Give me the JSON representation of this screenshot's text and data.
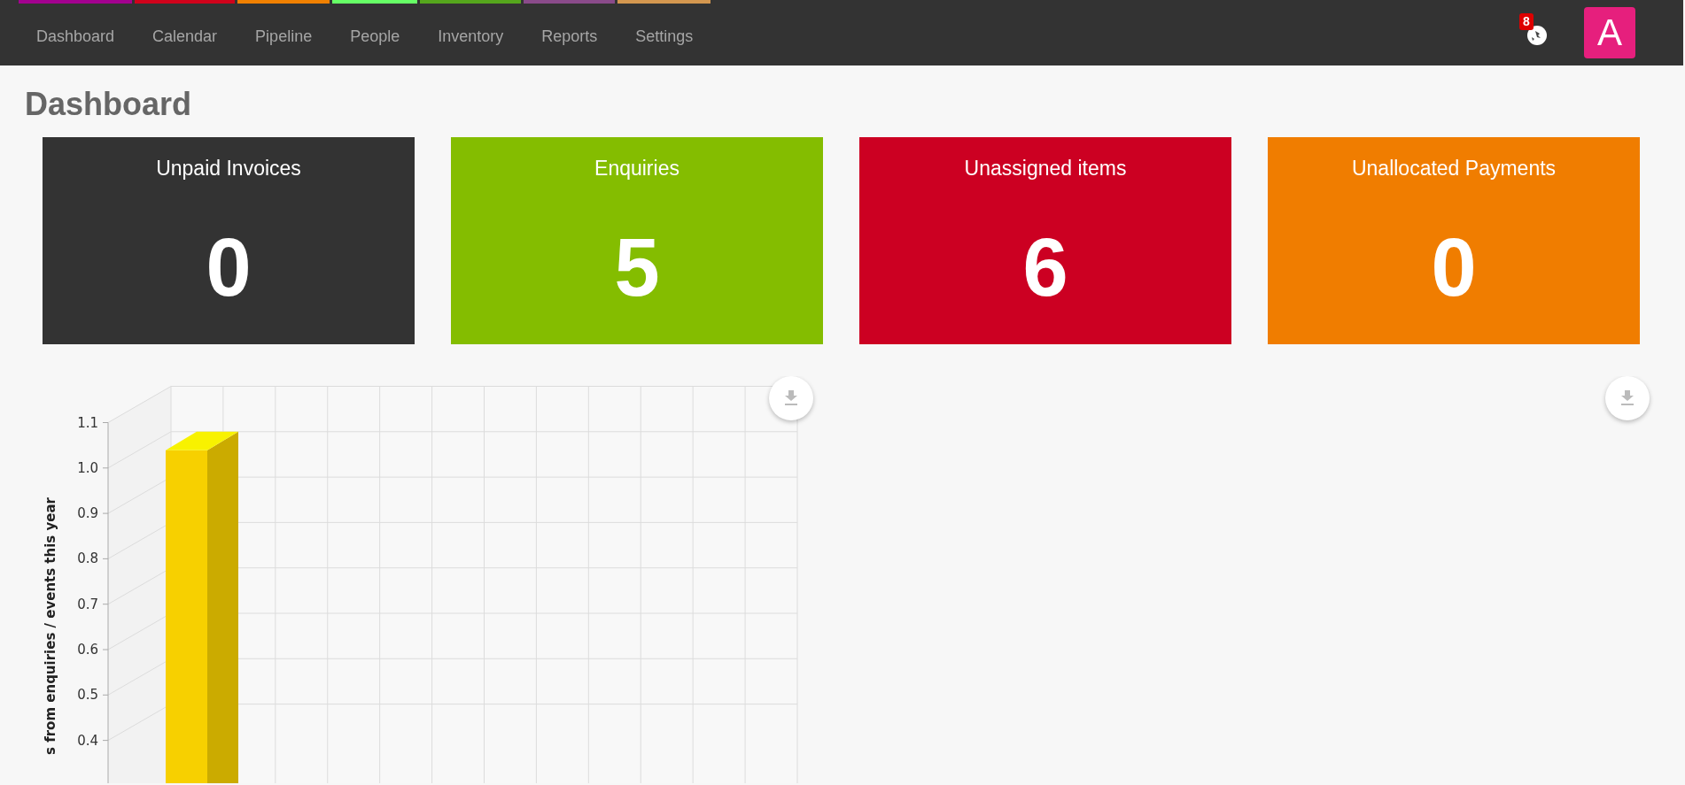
{
  "nav": {
    "items": [
      {
        "label": "Dashboard",
        "color": "#a3008f"
      },
      {
        "label": "Calendar",
        "color": "#d0021b"
      },
      {
        "label": "Pipeline",
        "color": "#f08000"
      },
      {
        "label": "People",
        "color": "#66ff66"
      },
      {
        "label": "Inventory",
        "color": "#55a61c"
      },
      {
        "label": "Reports",
        "color": "#8a4b8a"
      },
      {
        "label": "Settings",
        "color": "#d4974f"
      }
    ],
    "notification_count": "8",
    "avatar_initial": "A"
  },
  "page_title": "Dashboard",
  "stat_cards": [
    {
      "title": "Unpaid Invoices",
      "value": "0",
      "color": "#333333"
    },
    {
      "title": "Enquiries",
      "value": "5",
      "color": "#84bd00"
    },
    {
      "title": "Unassigned items",
      "value": "6",
      "color": "#cc0022"
    },
    {
      "title": "Unallocated Payments",
      "value": "0",
      "color": "#f07d00"
    }
  ],
  "chart": {
    "y_axis_title": "s from enquiries / events this year",
    "y_tick_labels": [
      "1.1",
      "1.0",
      "0.9",
      "0.8",
      "0.7",
      "0.6",
      "0.5",
      "0.4"
    ]
  }
}
